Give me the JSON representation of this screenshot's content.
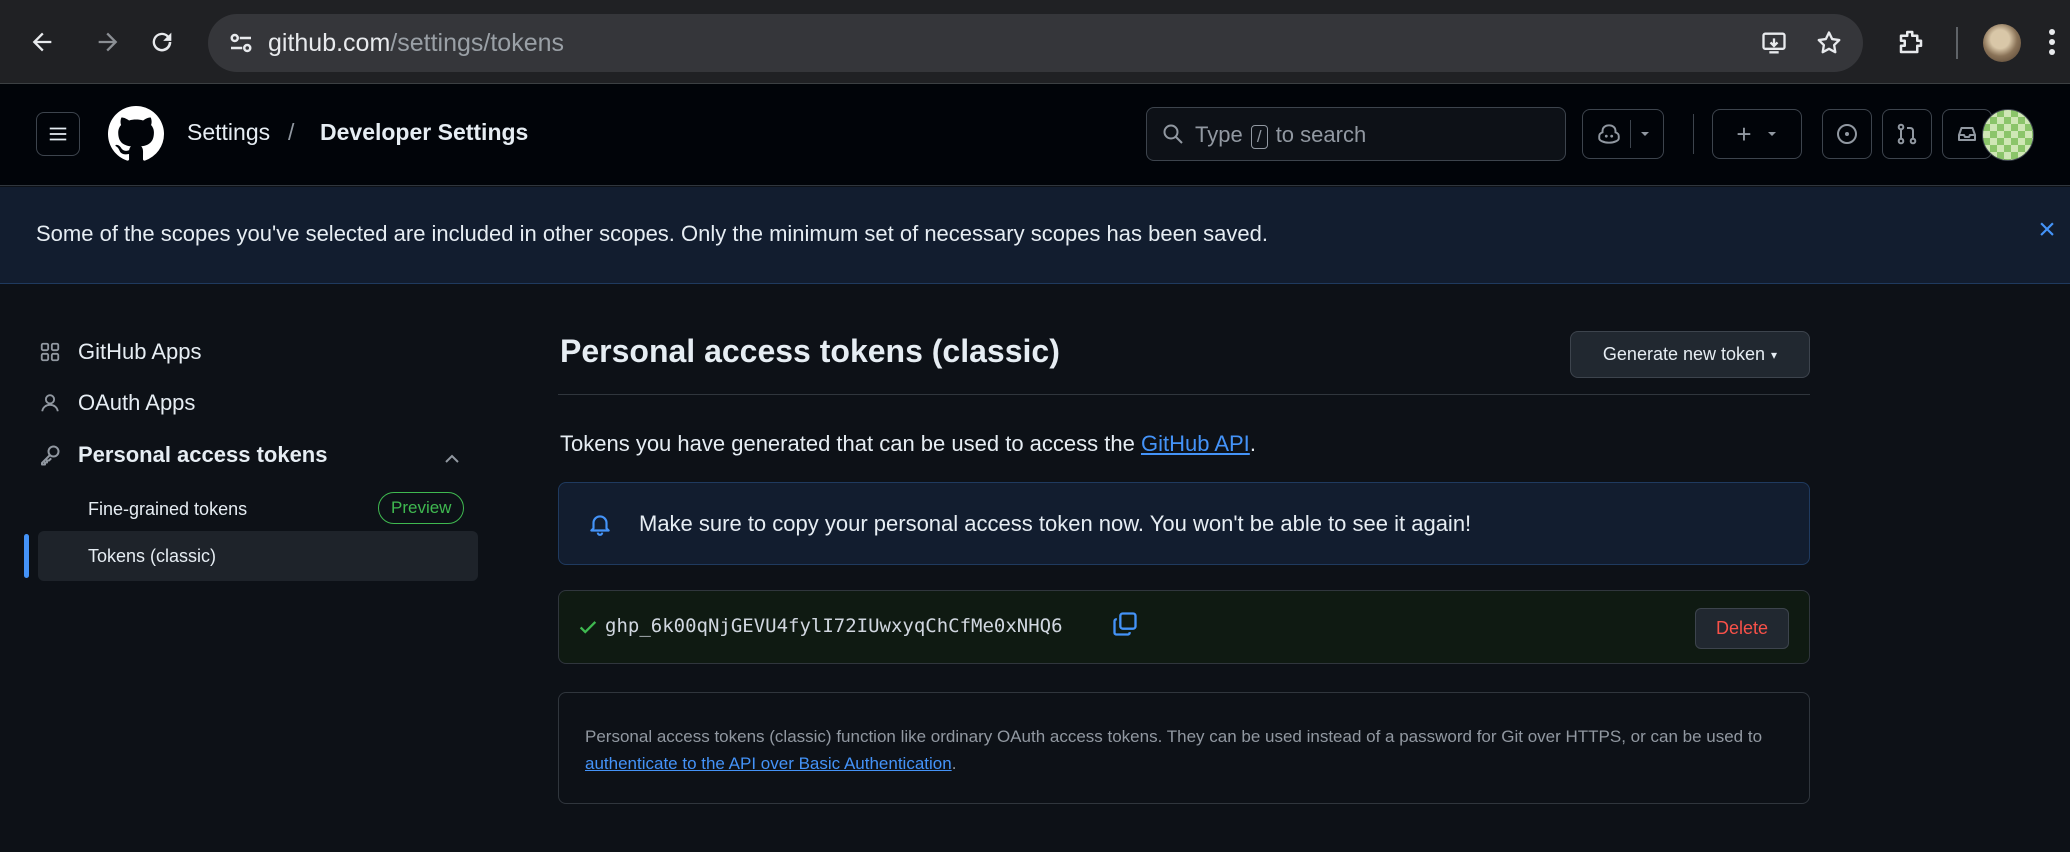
{
  "browser": {
    "url_host": "github.com",
    "url_path": "/settings/tokens"
  },
  "header": {
    "breadcrumb_settings": "Settings",
    "breadcrumb_separator": "/",
    "breadcrumb_current": "Developer Settings",
    "search_prefix": "Type",
    "search_key": "/",
    "search_suffix": "to search",
    "new_label": "+"
  },
  "flash": {
    "message": "Some of the scopes you've selected are included in other scopes. Only the minimum set of necessary scopes has been saved.",
    "close_icon": "×"
  },
  "sidebar": {
    "items": [
      {
        "label": "GitHub Apps",
        "icon": "apps-icon"
      },
      {
        "label": "OAuth Apps",
        "icon": "person-icon"
      },
      {
        "label": "Personal access tokens",
        "icon": "key-icon",
        "expanded": true
      }
    ],
    "sub_items": [
      {
        "label": "Fine-grained tokens",
        "badge": "Preview"
      },
      {
        "label": "Tokens (classic)",
        "selected": true
      }
    ]
  },
  "main": {
    "title": "Personal access tokens (classic)",
    "generate_button": "Generate new token",
    "intro_text": "Tokens you have generated that can be used to access the",
    "intro_link": "GitHub API",
    "intro_end": ".",
    "notice": "Make sure to copy your personal access token now. You won't be able to see it again!",
    "token": "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",
    "delete_button": "Delete",
    "info_text": "Personal access tokens (classic) function like ordinary OAuth access tokens. They can be used instead of a password for Git over HTTPS, or can be used to",
    "info_link": "authenticate to the API over Basic Authentication",
    "info_end": "."
  },
  "colors": {
    "accent": "#4493f8",
    "success": "#3fb950",
    "danger": "#f85149",
    "background": "#0d1117"
  }
}
